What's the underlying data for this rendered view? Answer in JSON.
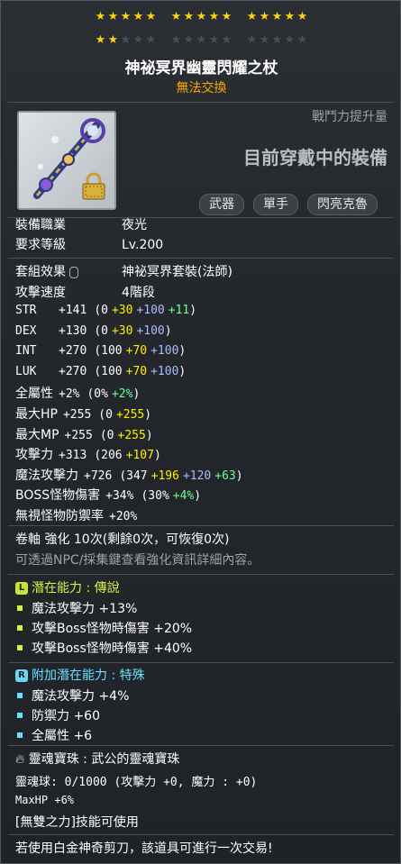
{
  "stars": {
    "rows": [
      [
        5,
        5,
        5
      ],
      [
        2,
        0,
        0
      ]
    ],
    "per_group": 5
  },
  "item": {
    "name": "神祕冥界幽靈閃耀之杖",
    "trade": "無法交換",
    "cp_label": "戰鬥力提升量",
    "equipped_text": "目前穿戴中的裝備",
    "tags": [
      "武器",
      "單手",
      "閃亮克魯"
    ]
  },
  "basic": [
    {
      "label": "裝備職業",
      "value": "夜光"
    },
    {
      "label": "要求等級",
      "value": "Lv.200"
    }
  ],
  "set": {
    "label": "套組效果",
    "value": "神祕冥界套裝(法師)"
  },
  "speed": {
    "label": "攻擊速度",
    "value": "4階段"
  },
  "stats": [
    {
      "label": "STR",
      "total": "+141",
      "base": "(0",
      "a": "+30",
      "b": "+100",
      "c": "+11",
      "end": ")"
    },
    {
      "label": "DEX",
      "total": "+130",
      "base": "(0",
      "a": "+30",
      "b": "+100",
      "c": "",
      "end": ")"
    },
    {
      "label": "INT",
      "total": "+270",
      "base": "(100",
      "a": "+70",
      "b": "+100",
      "c": "",
      "end": ")"
    },
    {
      "label": "LUK",
      "total": "+270",
      "base": "(100",
      "a": "+70",
      "b": "+100",
      "c": "",
      "end": ")"
    },
    {
      "label": "全屬性",
      "total": "+2%",
      "base": "(0%",
      "a": "",
      "b": "",
      "c": "+2%",
      "end": ")"
    },
    {
      "label": "最大HP",
      "total": "+255",
      "base": "(0",
      "a": "+255",
      "b": "",
      "c": "",
      "end": ")"
    },
    {
      "label": "最大MP",
      "total": "+255",
      "base": "(0",
      "a": "+255",
      "b": "",
      "c": "",
      "end": ")"
    },
    {
      "label": "攻擊力",
      "total": "+313",
      "base": "(206",
      "a": "+107",
      "b": "",
      "c": "",
      "end": ")"
    },
    {
      "label": "魔法攻擊力",
      "total": "+726",
      "base": "(347",
      "a": "+196",
      "b": "+120",
      "c": "+63",
      "end": ")"
    },
    {
      "label": "BOSS怪物傷害",
      "total": "+34%",
      "base": "(30%",
      "a": "",
      "b": "",
      "c": "+4%",
      "end": ")"
    },
    {
      "label": "無視怪物防禦率",
      "total": "+20%",
      "base": "",
      "a": "",
      "b": "",
      "c": "",
      "end": ""
    }
  ],
  "upgrade": {
    "text": "卷軸 強化 10次(剩餘0次，可恢復0次)",
    "hint": "可透過NPC/採集鍵查看強化資訊詳細內容。"
  },
  "potential": {
    "badge": "L",
    "title": "潛在能力 : 傳說",
    "color": "#d6f046",
    "lines": [
      "魔法攻擊力 +13%",
      "攻擊Boss怪物時傷害 +20%",
      "攻擊Boss怪物時傷害 +40%"
    ]
  },
  "bonus": {
    "badge": "R",
    "title": "附加潛在能力 : 特殊",
    "color": "#66e0ff",
    "lines": [
      "魔法攻擊力 +4%",
      "防禦力 +60",
      "全屬性 +6"
    ]
  },
  "soul": {
    "title": "靈魂寶珠 : 武公的靈魂寶珠",
    "line": "靈魂球: 0/1000 (攻擊力 +0, 魔力 : +0)",
    "maxhp": "MaxHP +6%",
    "skill": "[無雙之力]技能可使用"
  },
  "footer": "若使用白金神奇剪刀，該道具可進行一次交易!"
}
